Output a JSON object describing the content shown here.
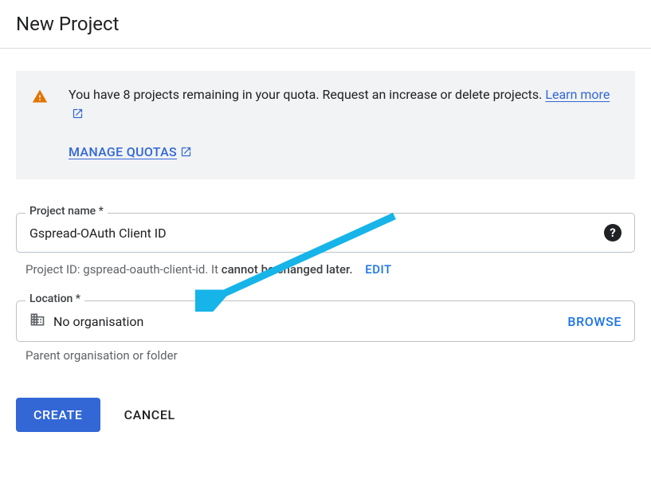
{
  "header": {
    "title": "New Project"
  },
  "notice": {
    "text_a": "You have 8 projects remaining in your quota. Request an increase or delete projects. ",
    "learn_more": "Learn more",
    "manage": "MANAGE QUOTAS"
  },
  "project_name": {
    "label": "Project name *",
    "value": "Gspread-OAuth Client ID",
    "hint_prefix": "Project ID: ",
    "project_id": "gspread-oauth-client-id",
    "hint_suffix": ". It ",
    "hint_strong": "cannot be changed later.",
    "edit": "EDIT"
  },
  "location": {
    "label": "Location *",
    "value": "No organisation",
    "browse": "BROWSE",
    "hint": "Parent organisation or folder"
  },
  "actions": {
    "create": "CREATE",
    "cancel": "CANCEL"
  }
}
